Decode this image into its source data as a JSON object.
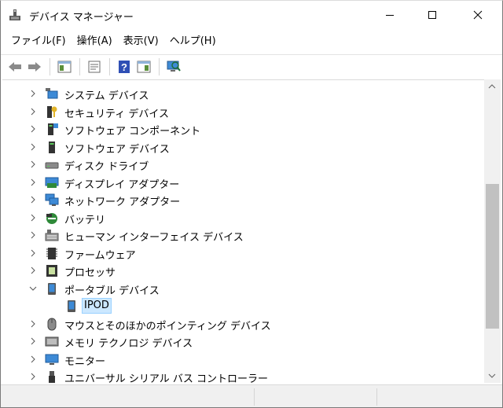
{
  "window": {
    "title": "デバイス マネージャー"
  },
  "menu": [
    "ファイル(F)",
    "操作(A)",
    "表示(V)",
    "ヘルプ(H)"
  ],
  "toolbar": [
    "back-icon",
    "forward-icon",
    "properties-pane-icon",
    "properties-icon",
    "help-icon",
    "action-pane-icon",
    "scan-hardware-icon"
  ],
  "tree": [
    {
      "label": "システム デバイス",
      "icon": "system-devices-icon",
      "expanded": false
    },
    {
      "label": "セキュリティ デバイス",
      "icon": "security-devices-icon",
      "expanded": false
    },
    {
      "label": "ソフトウェア コンポーネント",
      "icon": "software-components-icon",
      "expanded": false
    },
    {
      "label": "ソフトウェア デバイス",
      "icon": "software-devices-icon",
      "expanded": false
    },
    {
      "label": "ディスク ドライブ",
      "icon": "disk-drive-icon",
      "expanded": false
    },
    {
      "label": "ディスプレイ アダプター",
      "icon": "display-adapter-icon",
      "expanded": false
    },
    {
      "label": "ネットワーク アダプター",
      "icon": "network-adapter-icon",
      "expanded": false
    },
    {
      "label": "バッテリ",
      "icon": "battery-icon",
      "expanded": false
    },
    {
      "label": "ヒューマン インターフェイス デバイス",
      "icon": "hid-icon",
      "expanded": false
    },
    {
      "label": "ファームウェア",
      "icon": "firmware-icon",
      "expanded": false
    },
    {
      "label": "プロセッサ",
      "icon": "processor-icon",
      "expanded": false
    },
    {
      "label": "ポータブル デバイス",
      "icon": "portable-device-icon",
      "expanded": true,
      "children": [
        {
          "label": "IPOD",
          "icon": "portable-device-icon"
        }
      ]
    },
    {
      "label": "マウスとそのほかのポインティング デバイス",
      "icon": "mouse-icon",
      "expanded": false
    },
    {
      "label": "メモリ テクノロジ デバイス",
      "icon": "memory-tech-icon",
      "expanded": false
    },
    {
      "label": "モニター",
      "icon": "monitor-icon",
      "expanded": false
    },
    {
      "label": "ユニバーサル シリアル バス コントローラー",
      "icon": "usb-icon",
      "expanded": false
    }
  ]
}
